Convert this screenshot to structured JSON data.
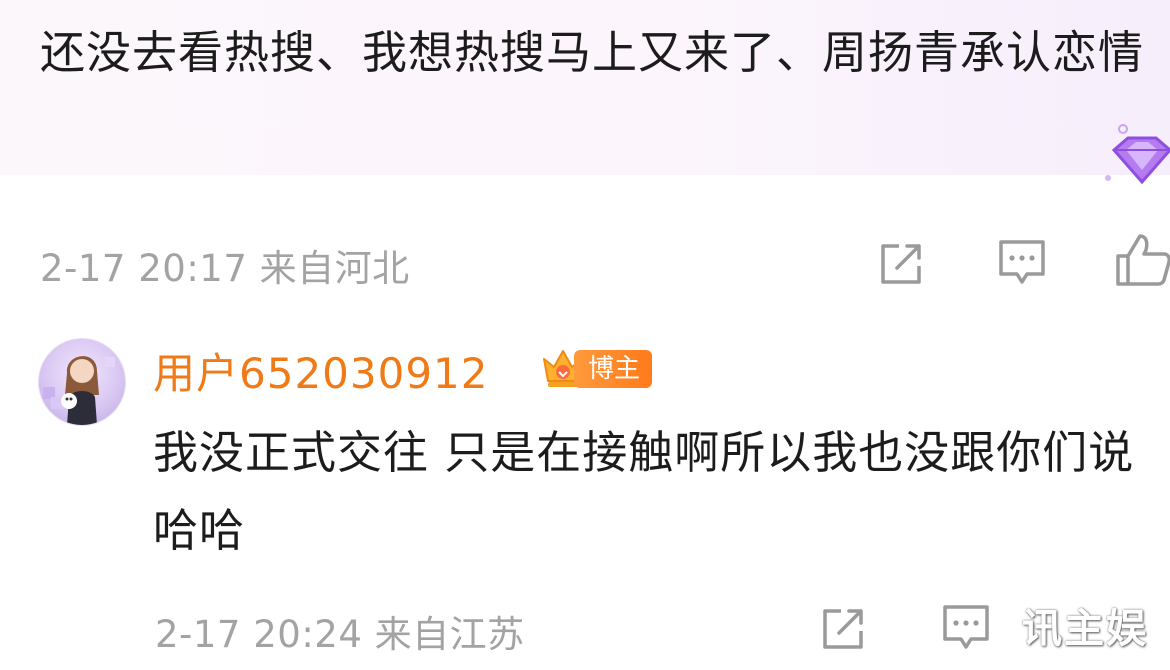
{
  "comment": {
    "text": "还没去看热搜、我想热搜马上又来了、周扬青承认恋情",
    "meta": "2-17 20:17 来自河北"
  },
  "reply": {
    "username": "用户652030912",
    "badge": "博主",
    "text": "我没正式交往 只是在接触啊所以我也没跟你们说哈哈",
    "meta": "2-17 20:24 来自江苏"
  },
  "watermark": "讯主娱",
  "colors": {
    "username": "#f07a16",
    "meta": "#a3a3a3",
    "badge": "#ff8a2a",
    "icon": "#9a9a9a"
  },
  "icons": [
    "share-icon",
    "comment-icon",
    "like-icon",
    "avatar",
    "crown-icon",
    "gem-icon"
  ]
}
